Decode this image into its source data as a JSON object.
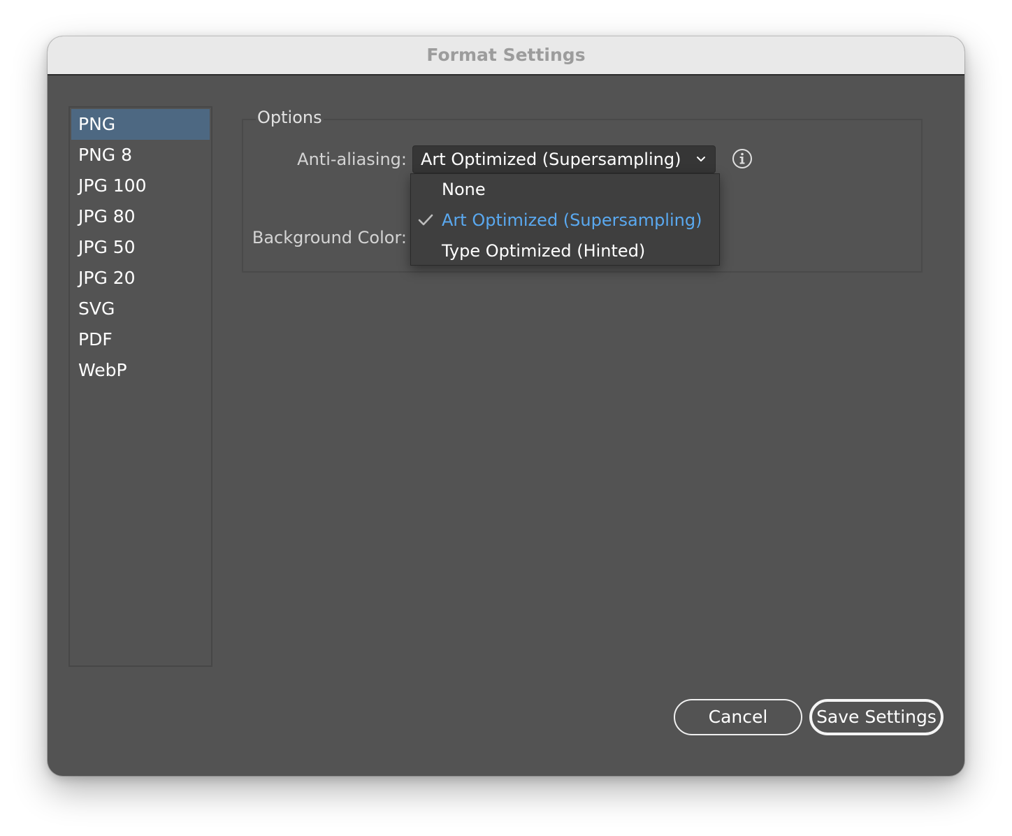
{
  "window": {
    "title": "Format Settings"
  },
  "sidebar": {
    "items": [
      {
        "label": "PNG",
        "selected": true
      },
      {
        "label": "PNG 8",
        "selected": false
      },
      {
        "label": "JPG 100",
        "selected": false
      },
      {
        "label": "JPG 80",
        "selected": false
      },
      {
        "label": "JPG 50",
        "selected": false
      },
      {
        "label": "JPG 20",
        "selected": false
      },
      {
        "label": "SVG",
        "selected": false
      },
      {
        "label": "PDF",
        "selected": false
      },
      {
        "label": "WebP",
        "selected": false
      }
    ]
  },
  "options": {
    "group_title": "Options",
    "anti_aliasing": {
      "label": "Anti-aliasing:",
      "value": "Art Optimized (Supersampling)",
      "icon": "chevron-down-icon",
      "info_icon": "info-icon",
      "menu": {
        "open": true,
        "items": [
          {
            "label": "None",
            "checked": false
          },
          {
            "label": "Art Optimized (Supersampling)",
            "checked": true
          },
          {
            "label": "Type Optimized (Hinted)",
            "checked": false
          }
        ]
      }
    },
    "background_color": {
      "label": "Background Color:"
    }
  },
  "footer": {
    "cancel_label": "Cancel",
    "save_label": "Save Settings"
  },
  "colors": {
    "panel_bg": "#535353",
    "selection_bg": "#4d6882",
    "checked_item": "#5aa9f0",
    "titlebar_bg": "#e9e9e9"
  }
}
